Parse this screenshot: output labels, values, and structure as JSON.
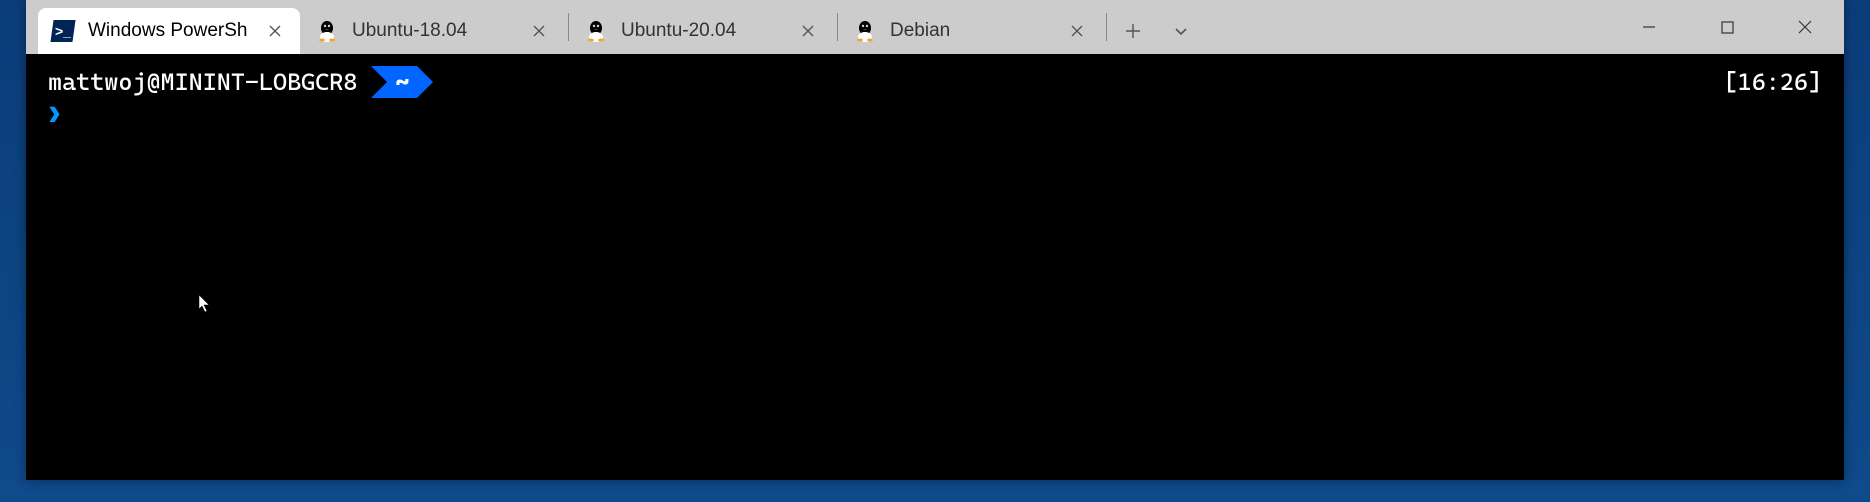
{
  "titlebar": {
    "tabs": [
      {
        "label": "Windows PowerSh",
        "icon": "powershell-icon",
        "active": true
      },
      {
        "label": "Ubuntu-18.04",
        "icon": "tux-icon",
        "active": false
      },
      {
        "label": "Ubuntu-20.04",
        "icon": "tux-icon",
        "active": false
      },
      {
        "label": "Debian",
        "icon": "tux-icon",
        "active": false
      }
    ],
    "new_tab_label": "+",
    "dropdown_label": "⌄"
  },
  "terminal": {
    "user_host": "mattwoj@MININT-LOBGCR8",
    "path_segment": "~",
    "time": "[16:26]",
    "prompt_char": "❯"
  }
}
